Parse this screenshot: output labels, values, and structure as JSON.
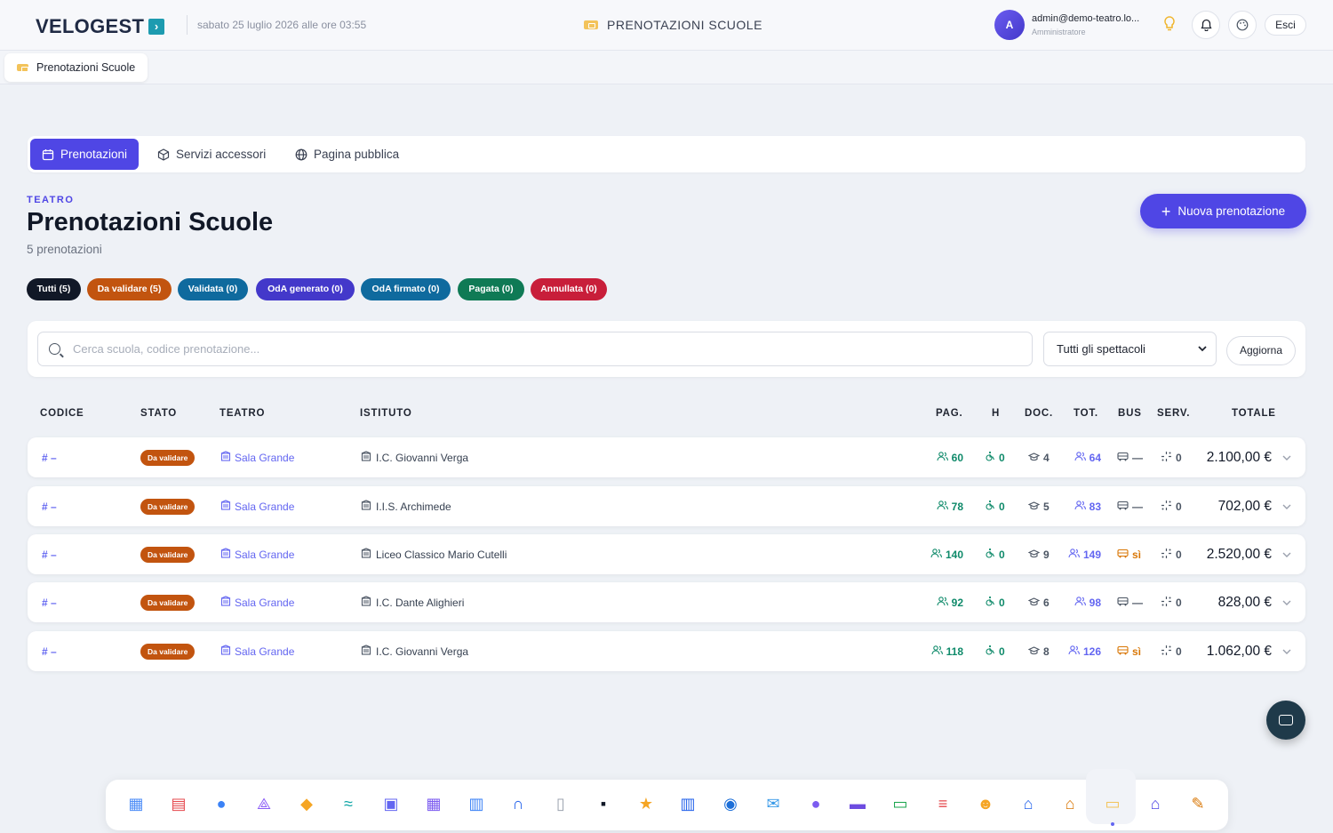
{
  "topbar": {
    "logo": "VELOGEST",
    "logo_badge": "›",
    "datetime": "sabato 25 luglio 2026 alle ore 03:55",
    "page_heading": "PRENOTAZIONI SCUOLE",
    "avatar_letter": "A",
    "user_email": "admin@demo-teatro.lo...",
    "user_role": "Amministratore",
    "logout_label": "Esci"
  },
  "open_tabs": [
    {
      "label": "Prenotazioni Scuole"
    }
  ],
  "subnav": [
    {
      "label": "Prenotazioni",
      "active": true
    },
    {
      "label": "Servizi accessori",
      "active": false
    },
    {
      "label": "Pagina pubblica",
      "active": false
    }
  ],
  "header": {
    "kicker": "TEATRO",
    "title": "Prenotazioni Scuole",
    "count": "5 prenotazioni",
    "new_button": "Nuova prenotazione"
  },
  "filters": [
    {
      "label": "Tutti (5)",
      "color": "#111827"
    },
    {
      "label": "Da validare (5)",
      "color": "#c2540f"
    },
    {
      "label": "Validata (0)",
      "color": "#0f6a9e"
    },
    {
      "label": "OdA generato (0)",
      "color": "#4338ca"
    },
    {
      "label": "OdA firmato (0)",
      "color": "#0f6a9e"
    },
    {
      "label": "Pagata (0)",
      "color": "#0f7a55"
    },
    {
      "label": "Annullata (0)",
      "color": "#c81e3a"
    }
  ],
  "search": {
    "placeholder": "Cerca scuola, codice prenotazione...",
    "show_select": "Tutti gli spettacoli",
    "refresh_label": "Aggiorna"
  },
  "table": {
    "columns": [
      "CODICE",
      "STATO",
      "TEATRO",
      "ISTITUTO",
      "PAG.",
      "H",
      "DOC.",
      "TOT.",
      "BUS",
      "SERV.",
      "TOTALE"
    ],
    "rows": [
      {
        "code": "# –",
        "status": "Da validare",
        "theatre": "Sala Grande",
        "institute": "I.C. Giovanni Verga",
        "paying": "60",
        "h": "0",
        "teachers": "4",
        "total_people": "64",
        "bus": "—",
        "bus_yes": false,
        "services": "0",
        "total": "2.100,00 €"
      },
      {
        "code": "# –",
        "status": "Da validare",
        "theatre": "Sala Grande",
        "institute": "I.I.S. Archimede",
        "paying": "78",
        "h": "0",
        "teachers": "5",
        "total_people": "83",
        "bus": "—",
        "bus_yes": false,
        "services": "0",
        "total": "702,00 €"
      },
      {
        "code": "# –",
        "status": "Da validare",
        "theatre": "Sala Grande",
        "institute": "Liceo Classico Mario Cutelli",
        "paying": "140",
        "h": "0",
        "teachers": "9",
        "total_people": "149",
        "bus": "sì",
        "bus_yes": true,
        "services": "0",
        "total": "2.520,00 €"
      },
      {
        "code": "# –",
        "status": "Da validare",
        "theatre": "Sala Grande",
        "institute": "I.C. Dante Alighieri",
        "paying": "92",
        "h": "0",
        "teachers": "6",
        "total_people": "98",
        "bus": "—",
        "bus_yes": false,
        "services": "0",
        "total": "828,00 €"
      },
      {
        "code": "# –",
        "status": "Da validare",
        "theatre": "Sala Grande",
        "institute": "I.C. Giovanni Verga",
        "paying": "118",
        "h": "0",
        "teachers": "8",
        "total_people": "126",
        "bus": "sì",
        "bus_yes": true,
        "services": "0",
        "total": "1.062,00 €"
      }
    ]
  },
  "dock": [
    {
      "name": "dashboard-icon",
      "glyph": "▦",
      "color": "#4f8ef7"
    },
    {
      "name": "calendar-icon",
      "glyph": "▤",
      "color": "#e5484d"
    },
    {
      "name": "users-icon",
      "glyph": "●",
      "color": "#3b82f6"
    },
    {
      "name": "network-icon",
      "glyph": "⟁",
      "color": "#8b5cf6"
    },
    {
      "name": "box-icon",
      "glyph": "◆",
      "color": "#f5a524"
    },
    {
      "name": "handshake-icon",
      "glyph": "≈",
      "color": "#0ea5a5"
    },
    {
      "name": "id-card-icon",
      "glyph": "▣",
      "color": "#6366f1"
    },
    {
      "name": "calculator-icon",
      "glyph": "▦",
      "color": "#7c5cf0"
    },
    {
      "name": "kanban-icon",
      "glyph": "▥",
      "color": "#3b82f6"
    },
    {
      "name": "headset-icon",
      "glyph": "∩",
      "color": "#2563eb"
    },
    {
      "name": "trash-icon",
      "glyph": "▯",
      "color": "#9ca3af"
    },
    {
      "name": "terminal-icon",
      "glyph": "▪",
      "color": "#111827"
    },
    {
      "name": "star-icon",
      "glyph": "★",
      "color": "#f5a524"
    },
    {
      "name": "building-icon",
      "glyph": "▥",
      "color": "#2563eb"
    },
    {
      "name": "globe-icon",
      "glyph": "◉",
      "color": "#1d6fd8"
    },
    {
      "name": "mail-icon",
      "glyph": "✉",
      "color": "#3b9be8"
    },
    {
      "name": "user-settings-icon",
      "glyph": "●",
      "color": "#7c5cf0"
    },
    {
      "name": "clapper-icon",
      "glyph": "▬",
      "color": "#6d4ce0"
    },
    {
      "name": "money-icon",
      "glyph": "▭",
      "color": "#16a34a"
    },
    {
      "name": "barrier-icon",
      "glyph": "≡",
      "color": "#e5484d"
    },
    {
      "name": "theater-masks-icon",
      "glyph": "☻",
      "color": "#f5a524"
    },
    {
      "name": "school-icon",
      "glyph": "⌂",
      "color": "#2563eb"
    },
    {
      "name": "museum-icon",
      "glyph": "⌂",
      "color": "#d97706"
    },
    {
      "name": "ticket-icon",
      "glyph": "▭",
      "color": "#f3c35a"
    },
    {
      "name": "home-icon",
      "glyph": "⌂",
      "color": "#4f46e5"
    },
    {
      "name": "note-edit-icon",
      "glyph": "✎",
      "color": "#d97706"
    }
  ]
}
